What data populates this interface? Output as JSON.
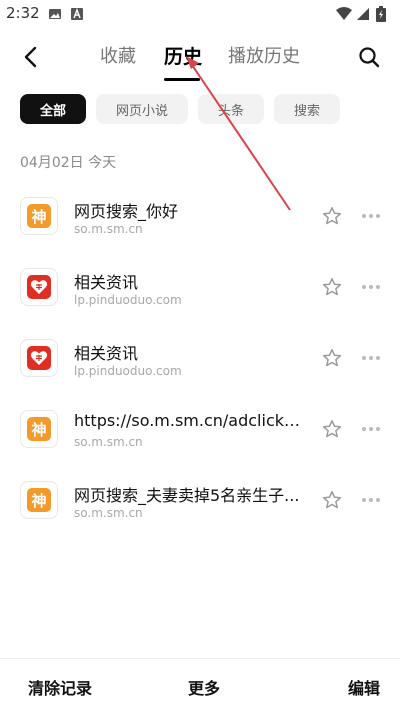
{
  "status_bar": {
    "time": "2:32",
    "icons": [
      "image-icon",
      "a-letter-icon",
      "wifi-icon",
      "signal-icon",
      "battery-charging-icon"
    ]
  },
  "header": {
    "back_icon": "chevron-left-icon",
    "tabs": [
      {
        "label": "收藏",
        "active": false
      },
      {
        "label": "历史",
        "active": true
      },
      {
        "label": "播放历史",
        "active": false
      }
    ],
    "search_icon": "search-icon"
  },
  "filters": [
    {
      "label": "全部",
      "active": true
    },
    {
      "label": "网页小说",
      "active": false
    },
    {
      "label": "头条",
      "active": false
    },
    {
      "label": "搜索",
      "active": false
    }
  ],
  "date_header": "04月02日 今天",
  "history": [
    {
      "icon": "shen-logo-icon",
      "icon_text": "神",
      "title": "网页搜索_你好",
      "url": "so.m.sm.cn"
    },
    {
      "icon": "pinduoduo-logo-icon",
      "title": "相关资讯",
      "url": "lp.pinduoduo.com"
    },
    {
      "icon": "pinduoduo-logo-icon",
      "title": "相关资讯",
      "url": "lp.pinduoduo.com"
    },
    {
      "icon": "shen-logo-icon",
      "icon_text": "神",
      "title": "https://so.m.sm.cn/adclick?u...",
      "url": "so.m.sm.cn"
    },
    {
      "icon": "shen-logo-icon",
      "icon_text": "神",
      "title": "网页搜索_夫妻卖掉5名亲生子...",
      "url": "so.m.sm.cn"
    }
  ],
  "bottom_bar": {
    "clear_label": "清除记录",
    "more_label": "更多",
    "edit_label": "编辑"
  },
  "colors": {
    "accent_dark": "#111111",
    "shen_logo": "#f39a2a",
    "pinduoduo_logo": "#e02e24",
    "annotation_arrow": "#d9434a"
  }
}
